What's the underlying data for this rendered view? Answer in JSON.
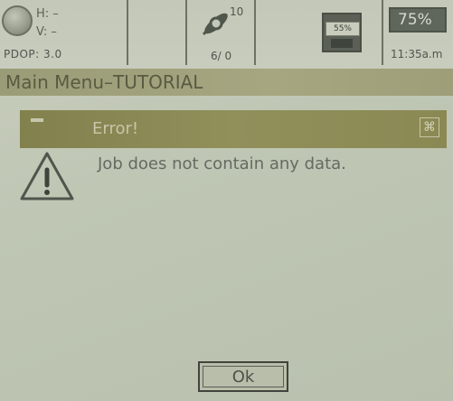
{
  "status": {
    "gps_h": "H: –",
    "gps_v": "V: –",
    "pdop": "PDOP: 3.0",
    "satellite_count": "10",
    "tilt": "6/ 0",
    "memory_label": "55%",
    "battery_label": "75%",
    "clock": "11:35a.m"
  },
  "menu": {
    "title": "Main Menu–TUTORIAL"
  },
  "dialog": {
    "title": "Error!",
    "close_symbol": "⌘",
    "message": "Job does not contain any data.",
    "ok_label": "Ok"
  },
  "icons": {
    "gps": "gps-status-icon",
    "satellite": "satellite-icon",
    "memory": "memory-card-icon",
    "battery": "battery-icon",
    "warning": "warning-icon"
  },
  "colors": {
    "screen_bg": "#c5cab8",
    "menu_bar": "#a4a47f",
    "dialog_titlebar": "#8a8954",
    "text": "#646b62"
  }
}
